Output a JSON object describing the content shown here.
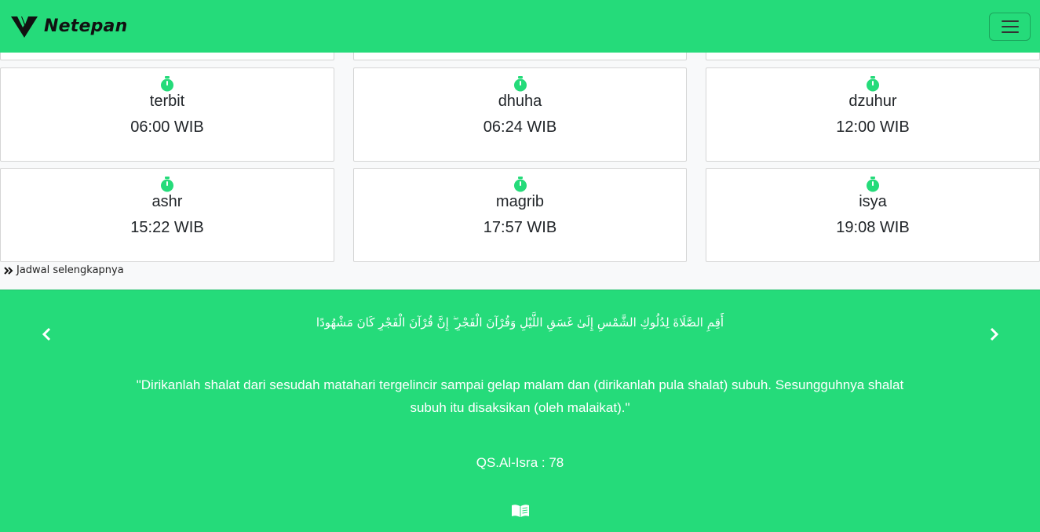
{
  "navbar": {
    "brand_name": "Netepan",
    "logo_icon": "v-logo-icon",
    "menu_icon": "hamburger-menu-icon"
  },
  "colors": {
    "accent": "#25db7a",
    "clock_icon": "#25db7a"
  },
  "prayer_times": [
    {
      "name": "terbit",
      "time": "06:00 WIB",
      "icon": "stopwatch-icon"
    },
    {
      "name": "dhuha",
      "time": "06:24 WIB",
      "icon": "stopwatch-icon"
    },
    {
      "name": "dzuhur",
      "time": "12:00 WIB",
      "icon": "stopwatch-icon"
    },
    {
      "name": "ashr",
      "time": "15:22 WIB",
      "icon": "stopwatch-icon"
    },
    {
      "name": "magrib",
      "time": "17:57 WIB",
      "icon": "stopwatch-icon"
    },
    {
      "name": "isya",
      "time": "19:08 WIB",
      "icon": "stopwatch-icon"
    }
  ],
  "more_link": {
    "label": "Jadwal selengkapnya",
    "icon": "double-chevron-right-icon"
  },
  "verse": {
    "arabic": "أَقِمِ الصَّلَاةَ لِدُلُوكِ الشَّمْسِ إِلَىٰ غَسَقِ اللَّيْلِ وَقُرْآنَ الْفَجْرِ ۖ إِنَّ قُرْآنَ الْفَجْرِ كَانَ مَشْهُودًا",
    "translation": "\"Dirikanlah shalat dari sesudah matahari tergelincir sampai gelap malam dan (dirikanlah pula shalat) subuh. Sesungguhnya shalat subuh itu disaksikan (oleh malaikat).\"",
    "source": "QS.Al-Isra : 78",
    "prev_icon": "chevron-left-icon",
    "next_icon": "chevron-right-icon",
    "book_icon": "open-book-icon"
  }
}
